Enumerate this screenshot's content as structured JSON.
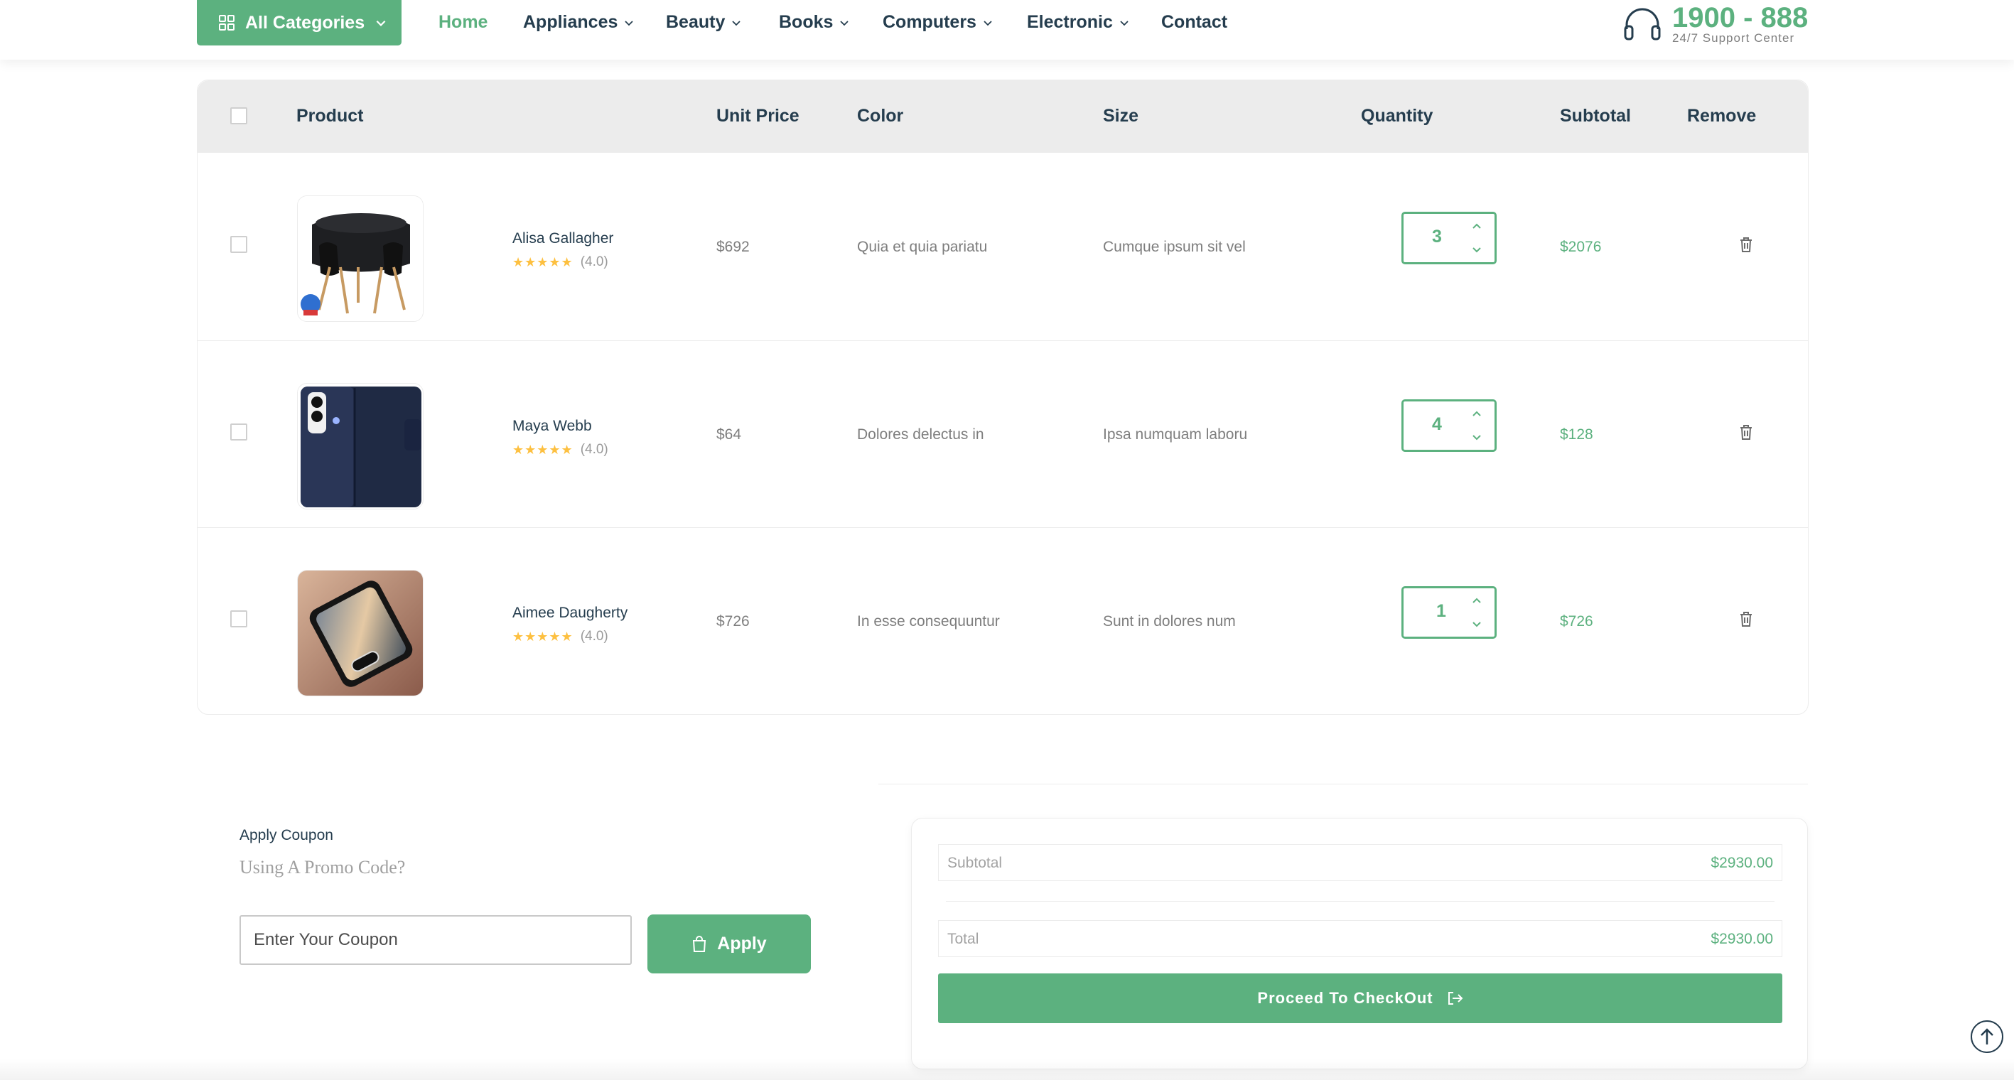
{
  "nav": {
    "all_categories": "All Categories",
    "items": [
      {
        "label": "Home",
        "active": true
      },
      {
        "label": "Appliances"
      },
      {
        "label": "Beauty"
      },
      {
        "label": "Books"
      },
      {
        "label": "Computers"
      },
      {
        "label": "Electronic"
      },
      {
        "label": "Contact"
      }
    ],
    "support_phone": "1900 - 888",
    "support_label": "24/7 Support Center",
    "accent_color": "#5cb17f"
  },
  "table": {
    "headers": {
      "product": "Product",
      "unit_price": "Unit Price",
      "color": "Color",
      "size": "Size",
      "quantity": "Quantity",
      "subtotal": "Subtotal",
      "remove": "Remove"
    },
    "rows": [
      {
        "name": "Alisa Gallagher",
        "rating": "(4.0)",
        "rating_value": 4.0,
        "price": "$692",
        "color": "Quia et quia pariatu",
        "size": "Cumque ipsum sit vel",
        "qty": "3",
        "subtotal": "$2076",
        "image": "black-dining-set"
      },
      {
        "name": "Maya Webb",
        "rating": "(4.0)",
        "rating_value": 4.0,
        "price": "$64",
        "color": "Dolores delectus in",
        "size": "Ipsa numquam laboru",
        "qty": "4",
        "subtotal": "$128",
        "image": "navy-phone-wallet-case"
      },
      {
        "name": "Aimee Daugherty",
        "rating": "(4.0)",
        "rating_value": 4.0,
        "price": "$726",
        "color": "In esse consequuntur",
        "size": "Sunt in dolores num",
        "qty": "1",
        "subtotal": "$726",
        "image": "clear-phone-case"
      }
    ]
  },
  "coupon": {
    "title": "Apply Coupon",
    "subtitle": "Using A Promo Code?",
    "placeholder": "Enter Your Coupon",
    "apply_label": "Apply"
  },
  "totals": {
    "subtotal_label": "Subtotal",
    "subtotal_value": "$2930.00",
    "total_label": "Total",
    "total_value": "$2930.00",
    "checkout_label": "Proceed To CheckOut"
  }
}
